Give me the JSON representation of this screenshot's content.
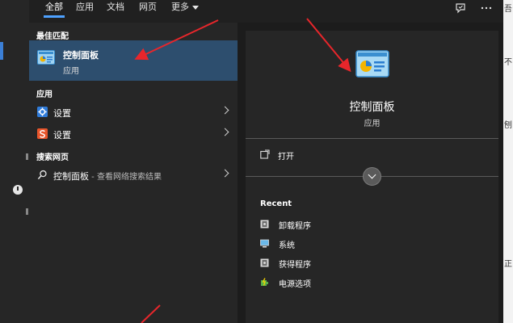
{
  "header": {
    "tabs": [
      {
        "label": "全部",
        "active": true
      },
      {
        "label": "应用",
        "active": false
      },
      {
        "label": "文档",
        "active": false
      },
      {
        "label": "网页",
        "active": false
      },
      {
        "label": "更多",
        "active": false
      }
    ],
    "icons": [
      "feedback-icon",
      "more-options-icon"
    ]
  },
  "results": {
    "best_match_label": "最佳匹配",
    "best_match": {
      "name": "控制面板",
      "type": "应用",
      "icon": "control-panel-icon"
    },
    "apps_label": "应用",
    "apps": [
      {
        "name": "设置",
        "icon": "settings-gear-icon",
        "color": "#2f7bd9"
      },
      {
        "name": "设置",
        "icon": "s-logo-icon",
        "color": "#e8552b"
      }
    ],
    "web_label": "搜索网页",
    "web": {
      "query": "控制面板",
      "suffix": " - 查看网络搜索结果",
      "icon": "search-icon"
    }
  },
  "preview": {
    "title": "控制面板",
    "subtitle": "应用",
    "open_label": "打开",
    "recent_label": "Recent",
    "recent_items": [
      {
        "label": "卸载程序",
        "icon": "uninstall-icon"
      },
      {
        "label": "系统",
        "icon": "monitor-icon"
      },
      {
        "label": "获得程序",
        "icon": "program-icon"
      },
      {
        "label": "电源选项",
        "icon": "power-options-icon"
      }
    ]
  },
  "background": {
    "right_chars": [
      "吾",
      "不",
      "刨",
      "正"
    ]
  },
  "colors": {
    "accent": "#4ea1ff",
    "selected_bg": "#2d4e6e",
    "arrow": "#e8262b"
  }
}
